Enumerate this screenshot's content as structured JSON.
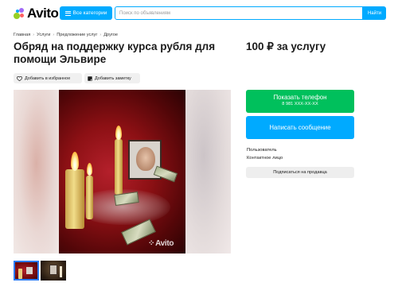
{
  "header": {
    "logo_text": "Avito",
    "logo_colors": [
      "#97cf26",
      "#a169f7",
      "#ff6163",
      "#0af"
    ],
    "categories_label": "Все категории",
    "search_placeholder": "Поиск по объявлениям",
    "search_button_label": "Найти",
    "accent_color": "#00aaff"
  },
  "breadcrumb": [
    "Главная",
    "Услуги",
    "Предложение услуг",
    "Другое"
  ],
  "listing": {
    "title": "Обряд на поддержку курса рубля для помощи Эльвире",
    "price": "100 ₽ за услугу",
    "favorite_label": "Добавить в избранное",
    "note_label": "Добавить заметку",
    "photo_watermark": "Avito"
  },
  "contact": {
    "phone_button_label": "Показать телефон",
    "phone_masked": "8 981 XXX-XX-XX",
    "phone_button_color": "#00c05c",
    "message_button_label": "Написать сообщение",
    "seller_label": "Пользователь",
    "seller_type": "Контактное лицо",
    "subscribe_label": "Подписаться на продавца"
  },
  "gallery": {
    "thumbnail_count": 2,
    "selected_index": 0
  }
}
